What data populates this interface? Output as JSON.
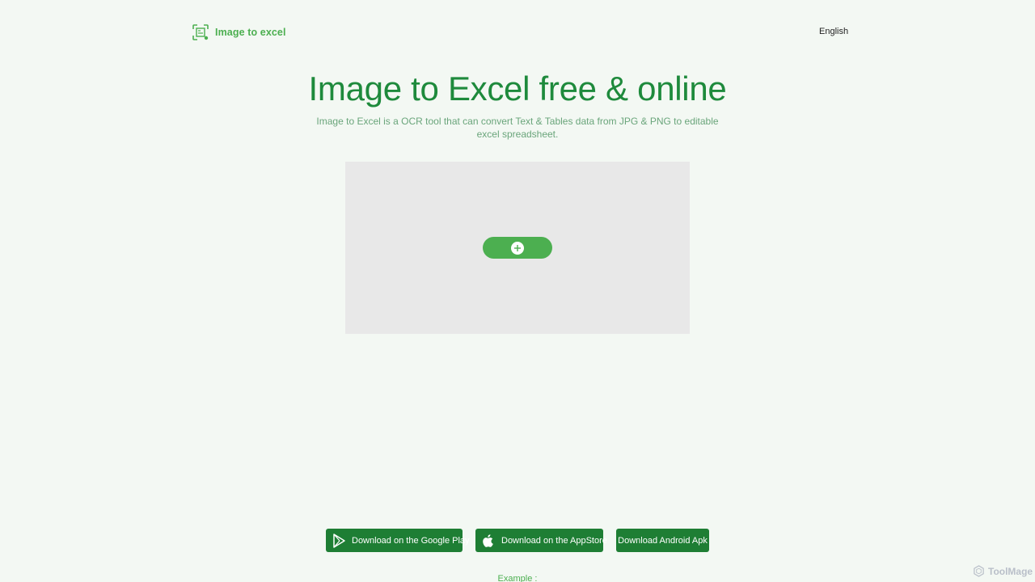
{
  "header": {
    "logo_text": "Image to excel",
    "language": "English"
  },
  "hero": {
    "title": "Image to Excel free & online",
    "description": "Image to Excel is a OCR tool that can convert Text & Tables data from JPG & PNG to editable excel spreadsheet."
  },
  "upload": {
    "button_icon": "plus-icon"
  },
  "downloads": {
    "google_play": "Download on the Google Play",
    "app_store": "Download on the AppStore",
    "android_apk": "Download Android Apk"
  },
  "example_label": "Example :",
  "watermark": "ToolMage",
  "colors": {
    "accent": "#4caf50",
    "title_green": "#1e8a3c",
    "button_dark_green": "#1e7e34",
    "background": "#f3f8f3",
    "dropzone": "#e8e8e8"
  }
}
